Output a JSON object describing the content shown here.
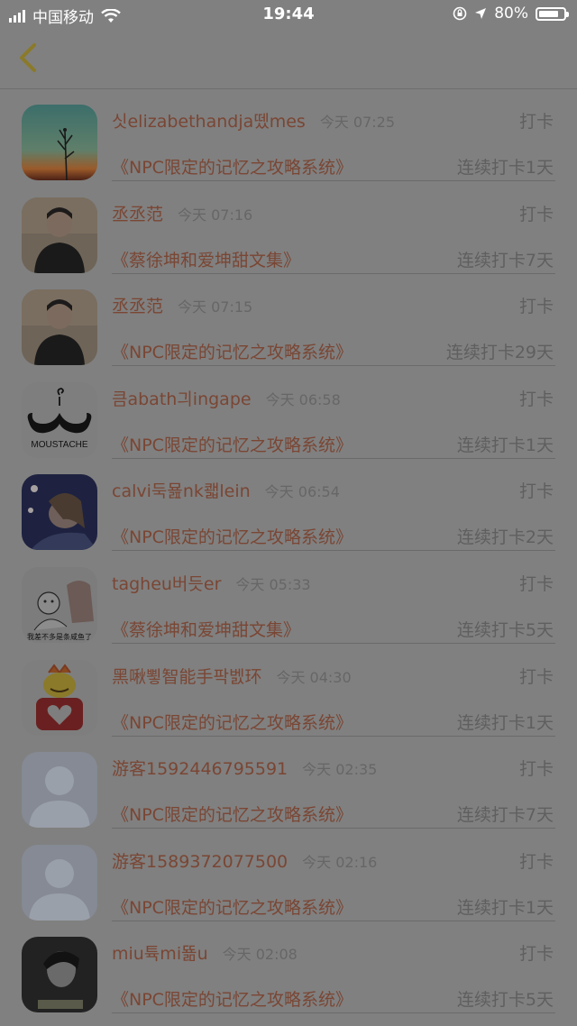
{
  "status_bar": {
    "carrier": "中国移动",
    "time": "19:44",
    "battery": "80%",
    "battery_level": 0.8
  },
  "records": [
    {
      "name": "싯elizabethandja뗐mes",
      "time": "今天 07:25",
      "action": "打卡",
      "book": "《NPC限定的记忆之攻略系统》",
      "streak": "连续打卡1天",
      "avatar": "sunset-plant-avatar"
    },
    {
      "name": "丞丞范",
      "time": "今天 07:16",
      "action": "打卡",
      "book": "《蔡徐坤和爱坤甜文集》",
      "streak": "连续打卡7天",
      "avatar": "person-photo-avatar"
    },
    {
      "name": "丞丞范",
      "time": "今天 07:15",
      "action": "打卡",
      "book": "《NPC限定的记忆之攻略系统》",
      "streak": "连续打卡29天",
      "avatar": "person-photo-avatar"
    },
    {
      "name": "큼abath긔ingape",
      "time": "今天 06:58",
      "action": "打卡",
      "book": "《NPC限定的记忆之攻略系统》",
      "streak": "连续打卡1天",
      "avatar": "moustache-avatar",
      "avatar_text": "MOUSTACHE"
    },
    {
      "name": "calvi둑묦nk쾗lein",
      "time": "今天 06:54",
      "action": "打卡",
      "book": "《NPC限定的记忆之攻略系统》",
      "streak": "连续打卡2天",
      "avatar": "night-portrait-avatar"
    },
    {
      "name": "tagheu버듯er",
      "time": "今天 05:33",
      "action": "打卡",
      "book": "《蔡徐坤和爱坤甜文集》",
      "streak": "连续打卡5天",
      "avatar": "cartoon-avatar",
      "avatar_text": "我差不多是条咸鱼了"
    },
    {
      "name": "黑啾뾯智能手팍벬环",
      "time": "今天 04:30",
      "action": "打卡",
      "book": "《NPC限定的记忆之攻略系统》",
      "streak": "连续打卡1天",
      "avatar": "heart-character-avatar"
    },
    {
      "name": "游客1592446795591",
      "time": "今天 02:35",
      "action": "打卡",
      "book": "《NPC限定的记忆之攻略系统》",
      "streak": "连续打卡7天",
      "avatar": "default-user-avatar"
    },
    {
      "name": "游客1589372077500",
      "time": "今天 02:16",
      "action": "打卡",
      "book": "《NPC限定的记忆之攻略系统》",
      "streak": "连续打卡1天",
      "avatar": "default-user-avatar"
    },
    {
      "name": "miu튝mi뚊u",
      "time": "今天 02:08",
      "action": "打卡",
      "book": "《NPC限定的记忆之攻略系统》",
      "streak": "连续打卡5天",
      "avatar": "portrait-bw-avatar"
    }
  ],
  "colors": {
    "overlay": "#808080",
    "name_accent": "#7a4634",
    "back_icon": "#8a7a2a"
  }
}
